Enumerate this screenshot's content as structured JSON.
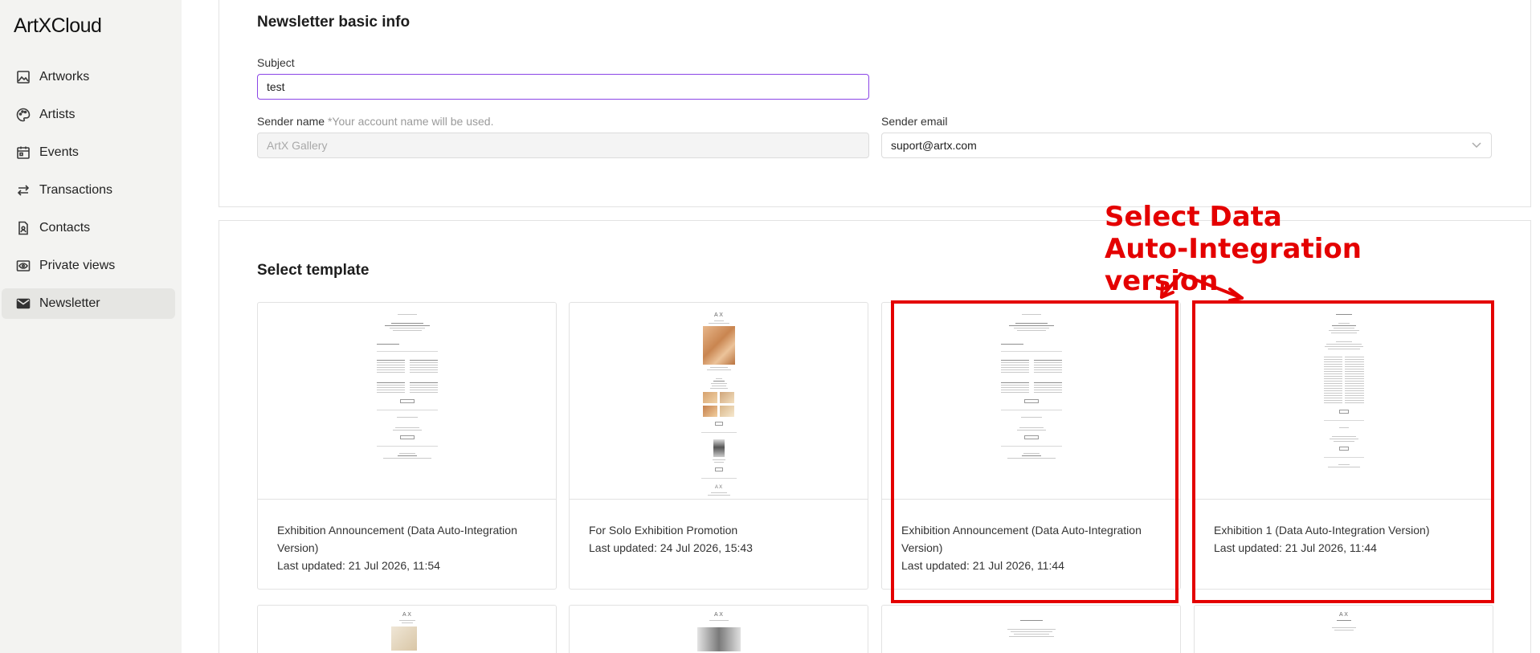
{
  "app": {
    "logo": "ArtXCloud"
  },
  "sidebar": {
    "items": [
      {
        "label": "Artworks",
        "icon": "image-icon",
        "active": false
      },
      {
        "label": "Artists",
        "icon": "palette-icon",
        "active": false
      },
      {
        "label": "Events",
        "icon": "calendar-icon",
        "active": false
      },
      {
        "label": "Transactions",
        "icon": "swap-arrows-icon",
        "active": false
      },
      {
        "label": "Contacts",
        "icon": "contact-file-icon",
        "active": false
      },
      {
        "label": "Private views",
        "icon": "eye-icon",
        "active": false
      },
      {
        "label": "Newsletter",
        "icon": "envelope-icon",
        "active": true
      }
    ]
  },
  "basic_info": {
    "title": "Newsletter basic info",
    "subject_label": "Subject",
    "subject_value": "test",
    "sender_name_label": "Sender name",
    "sender_name_hint": "*Your account name will be used.",
    "sender_name_value": "ArtX Gallery",
    "sender_email_label": "Sender email",
    "sender_email_value": "suport@artx.com"
  },
  "templates": {
    "title": "Select template",
    "items": [
      {
        "name": "Exhibition Announcement (Data Auto-Integration Version)",
        "updated": "Last updated: 21 Jul 2026, 11:54"
      },
      {
        "name": "For Solo Exhibition Promotion",
        "updated": "Last updated: 24 Jul 2026, 15:43"
      },
      {
        "name": "Exhibition Announcement (Data Auto-Integration Version)",
        "updated": "Last updated: 21 Jul 2026, 11:44"
      },
      {
        "name": "Exhibition 1 (Data Auto-Integration Version)",
        "updated": "Last updated: 21 Jul 2026, 11:44"
      }
    ]
  },
  "annotation": {
    "text": "Select Data Auto-Integration version",
    "color": "#e40000"
  },
  "colors": {
    "accent": "#8b45e6",
    "sidebar_bg": "#f3f3f1",
    "annotation_red": "#e40000"
  }
}
